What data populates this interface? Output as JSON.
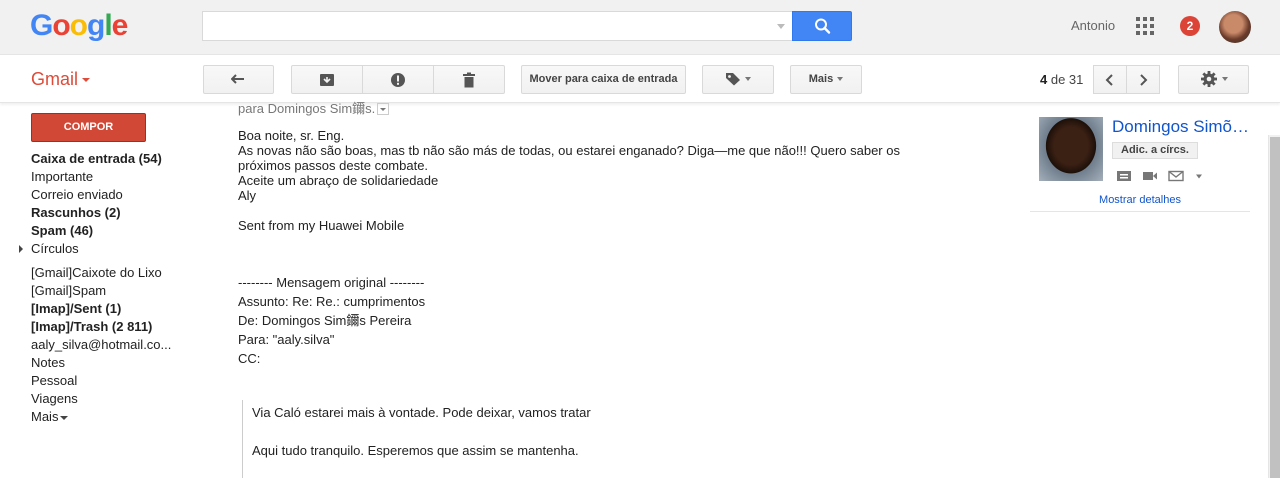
{
  "header": {
    "logo_letters": [
      {
        "ch": "G",
        "color": "#4285f4"
      },
      {
        "ch": "o",
        "color": "#ea4335"
      },
      {
        "ch": "o",
        "color": "#fbbc05"
      },
      {
        "ch": "g",
        "color": "#4285f4"
      },
      {
        "ch": "l",
        "color": "#34a853"
      },
      {
        "ch": "e",
        "color": "#ea4335"
      }
    ],
    "search_value": "",
    "user_name": "Antonio",
    "notification_count": "2"
  },
  "toolbar": {
    "app_label": "Gmail",
    "move_inbox_label": "Mover para caixa de entrada",
    "more_label": "Mais",
    "pager_current": "4",
    "pager_of": " de 31",
    "icons": [
      "back-icon",
      "archive-icon",
      "report-spam-icon",
      "delete-icon",
      "label-icon",
      "prev-icon",
      "next-icon",
      "settings-icon"
    ]
  },
  "compose_label": "COMPOR",
  "sidebar": {
    "items": [
      {
        "label": "Caixa de entrada (54)",
        "bold": true
      },
      {
        "label": "Importante",
        "bold": false
      },
      {
        "label": "Correio enviado",
        "bold": false
      },
      {
        "label": "Rascunhos (2)",
        "bold": true
      },
      {
        "label": "Spam (46)",
        "bold": true
      },
      {
        "label": "Círculos",
        "bold": false
      },
      {
        "label": "[Gmail]Caixote do Lixo",
        "bold": false
      },
      {
        "label": "[Gmail]Spam",
        "bold": false
      },
      {
        "label": "[Imap]/Sent (1)",
        "bold": true
      },
      {
        "label": "[Imap]/Trash (2 811)",
        "bold": true
      },
      {
        "label": "aaly_silva@hotmail.co...",
        "bold": false
      },
      {
        "label": "Notes",
        "bold": false
      },
      {
        "label": "Pessoal",
        "bold": false
      },
      {
        "label": "Viagens",
        "bold": false
      },
      {
        "label": "Mais",
        "bold": false
      }
    ]
  },
  "message": {
    "to_line": "para Domingos Sim鑈s.",
    "body": [
      "Boa noite, sr. Eng.",
      "As novas não são boas, mas tb não são más de todas, ou estarei enganado? Diga—me que não!!! Quero saber os próximos passos deste combate.",
      "Aceite um abraço de solidariedade",
      "Aly"
    ],
    "signature": "Sent from my Huawei Mobile",
    "original_header": "-------- Mensagem original --------",
    "subject": "Assunto: Re: Re.: cumprimentos",
    "from": "De: Domingos Sim鑈s Pereira",
    "to": "Para: \"aaly.silva\"",
    "cc": "CC:",
    "quote_1": "Via Caló estarei mais à vontade. Pode deixar, vamos tratar",
    "quote_2": "Aqui tudo tranquilo. Esperemos que assim se mantenha."
  },
  "contact": {
    "name": "Domingos Simões Pereira",
    "circles_button": "Adic. a círcs.",
    "details_link": "Mostrar detalhes"
  }
}
